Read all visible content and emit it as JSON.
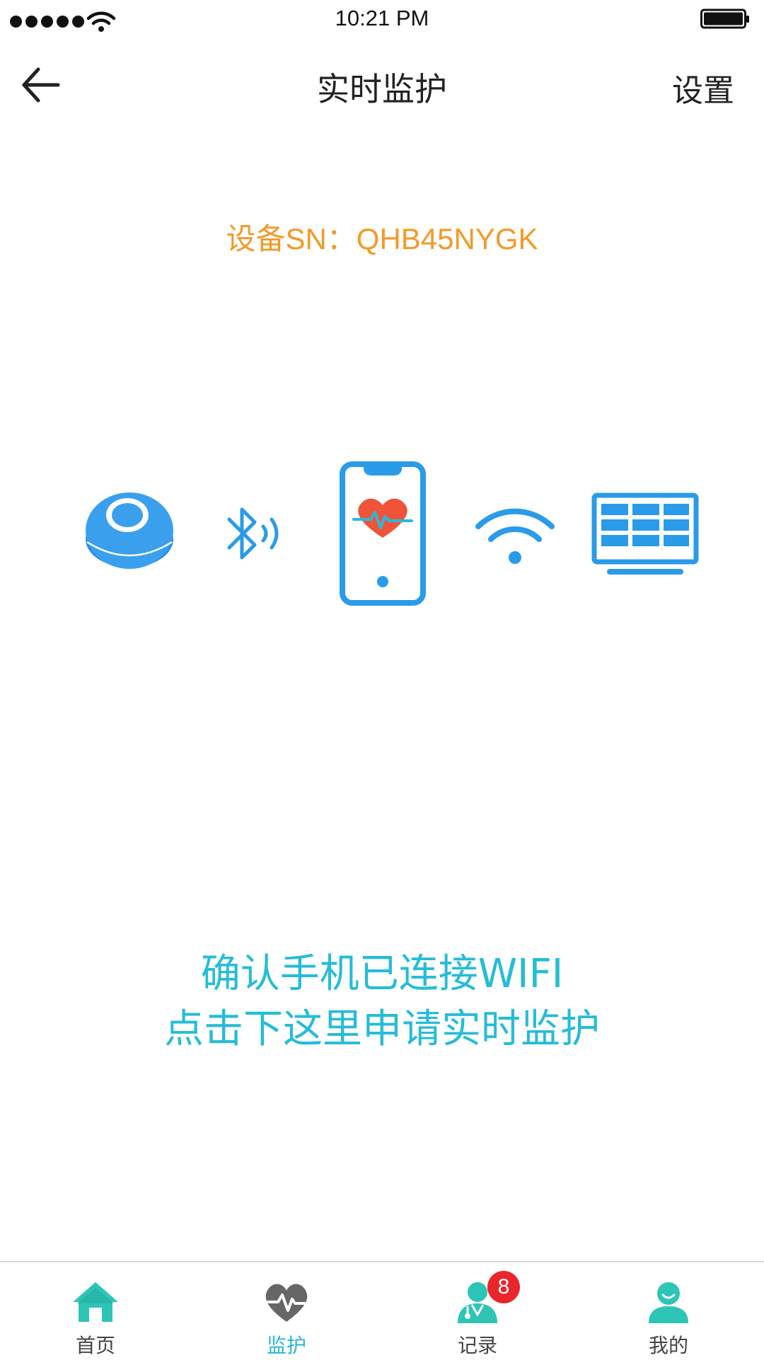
{
  "status_bar": {
    "time": "10:21 PM"
  },
  "nav": {
    "title": "实时监护",
    "settings_label": "设置"
  },
  "device": {
    "sn_text": "设备SN：QHB45NYGK"
  },
  "diagram": {
    "icons": [
      "sensor-device-icon",
      "bluetooth-icon",
      "phone-heart-icon",
      "wifi-icon",
      "monitor-screen-icon"
    ]
  },
  "instruction": {
    "line1": "确认手机已连接WIFI",
    "line2": "点击下这里申请实时监护"
  },
  "tabs": [
    {
      "label": "首页",
      "icon": "home-icon"
    },
    {
      "label": "监护",
      "icon": "heart-pulse-icon",
      "active": true
    },
    {
      "label": "记录",
      "icon": "doctor-icon",
      "badge": "8"
    },
    {
      "label": "我的",
      "icon": "profile-icon"
    }
  ],
  "colors": {
    "accent_teal": "#29b6d6",
    "sn_orange": "#f39a28",
    "diagram_blue": "#2196e8",
    "heart_red": "#f0533a",
    "badge_red": "#e8262c"
  }
}
